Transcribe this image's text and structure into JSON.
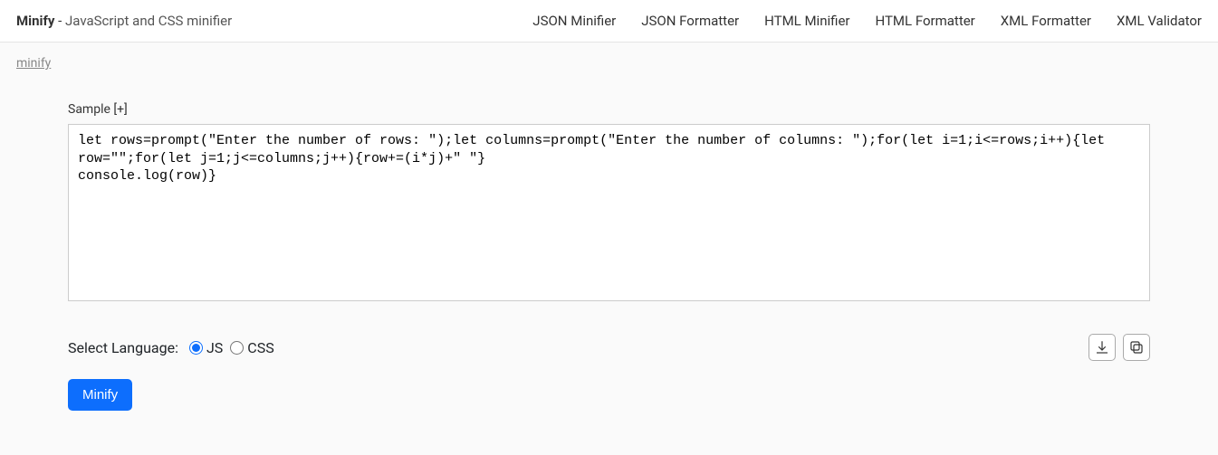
{
  "header": {
    "brand_strong": "Minify",
    "brand_sep": " - ",
    "brand_sub": "JavaScript and CSS minifier",
    "nav": {
      "json_minifier": "JSON Minifier",
      "json_formatter": "JSON Formatter",
      "html_minifier": "HTML Minifier",
      "html_formatter": "HTML Formatter",
      "xml_formatter": "XML Formatter",
      "xml_validator": "XML Validator"
    }
  },
  "breadcrumb": {
    "minify": "minify"
  },
  "main": {
    "sample_label": "Sample ",
    "sample_plus": "[+]",
    "code_value": "let rows=prompt(\"Enter the number of rows: \");let columns=prompt(\"Enter the number of columns: \");for(let i=1;i<=rows;i++){let row=\"\";for(let j=1;j<=columns;j++){row+=(i*j)+\" \"}\nconsole.log(row)}",
    "select_language_label": "Select Language:",
    "radio_js_label": "JS",
    "radio_css_label": "CSS",
    "minify_button_label": "Minify"
  }
}
